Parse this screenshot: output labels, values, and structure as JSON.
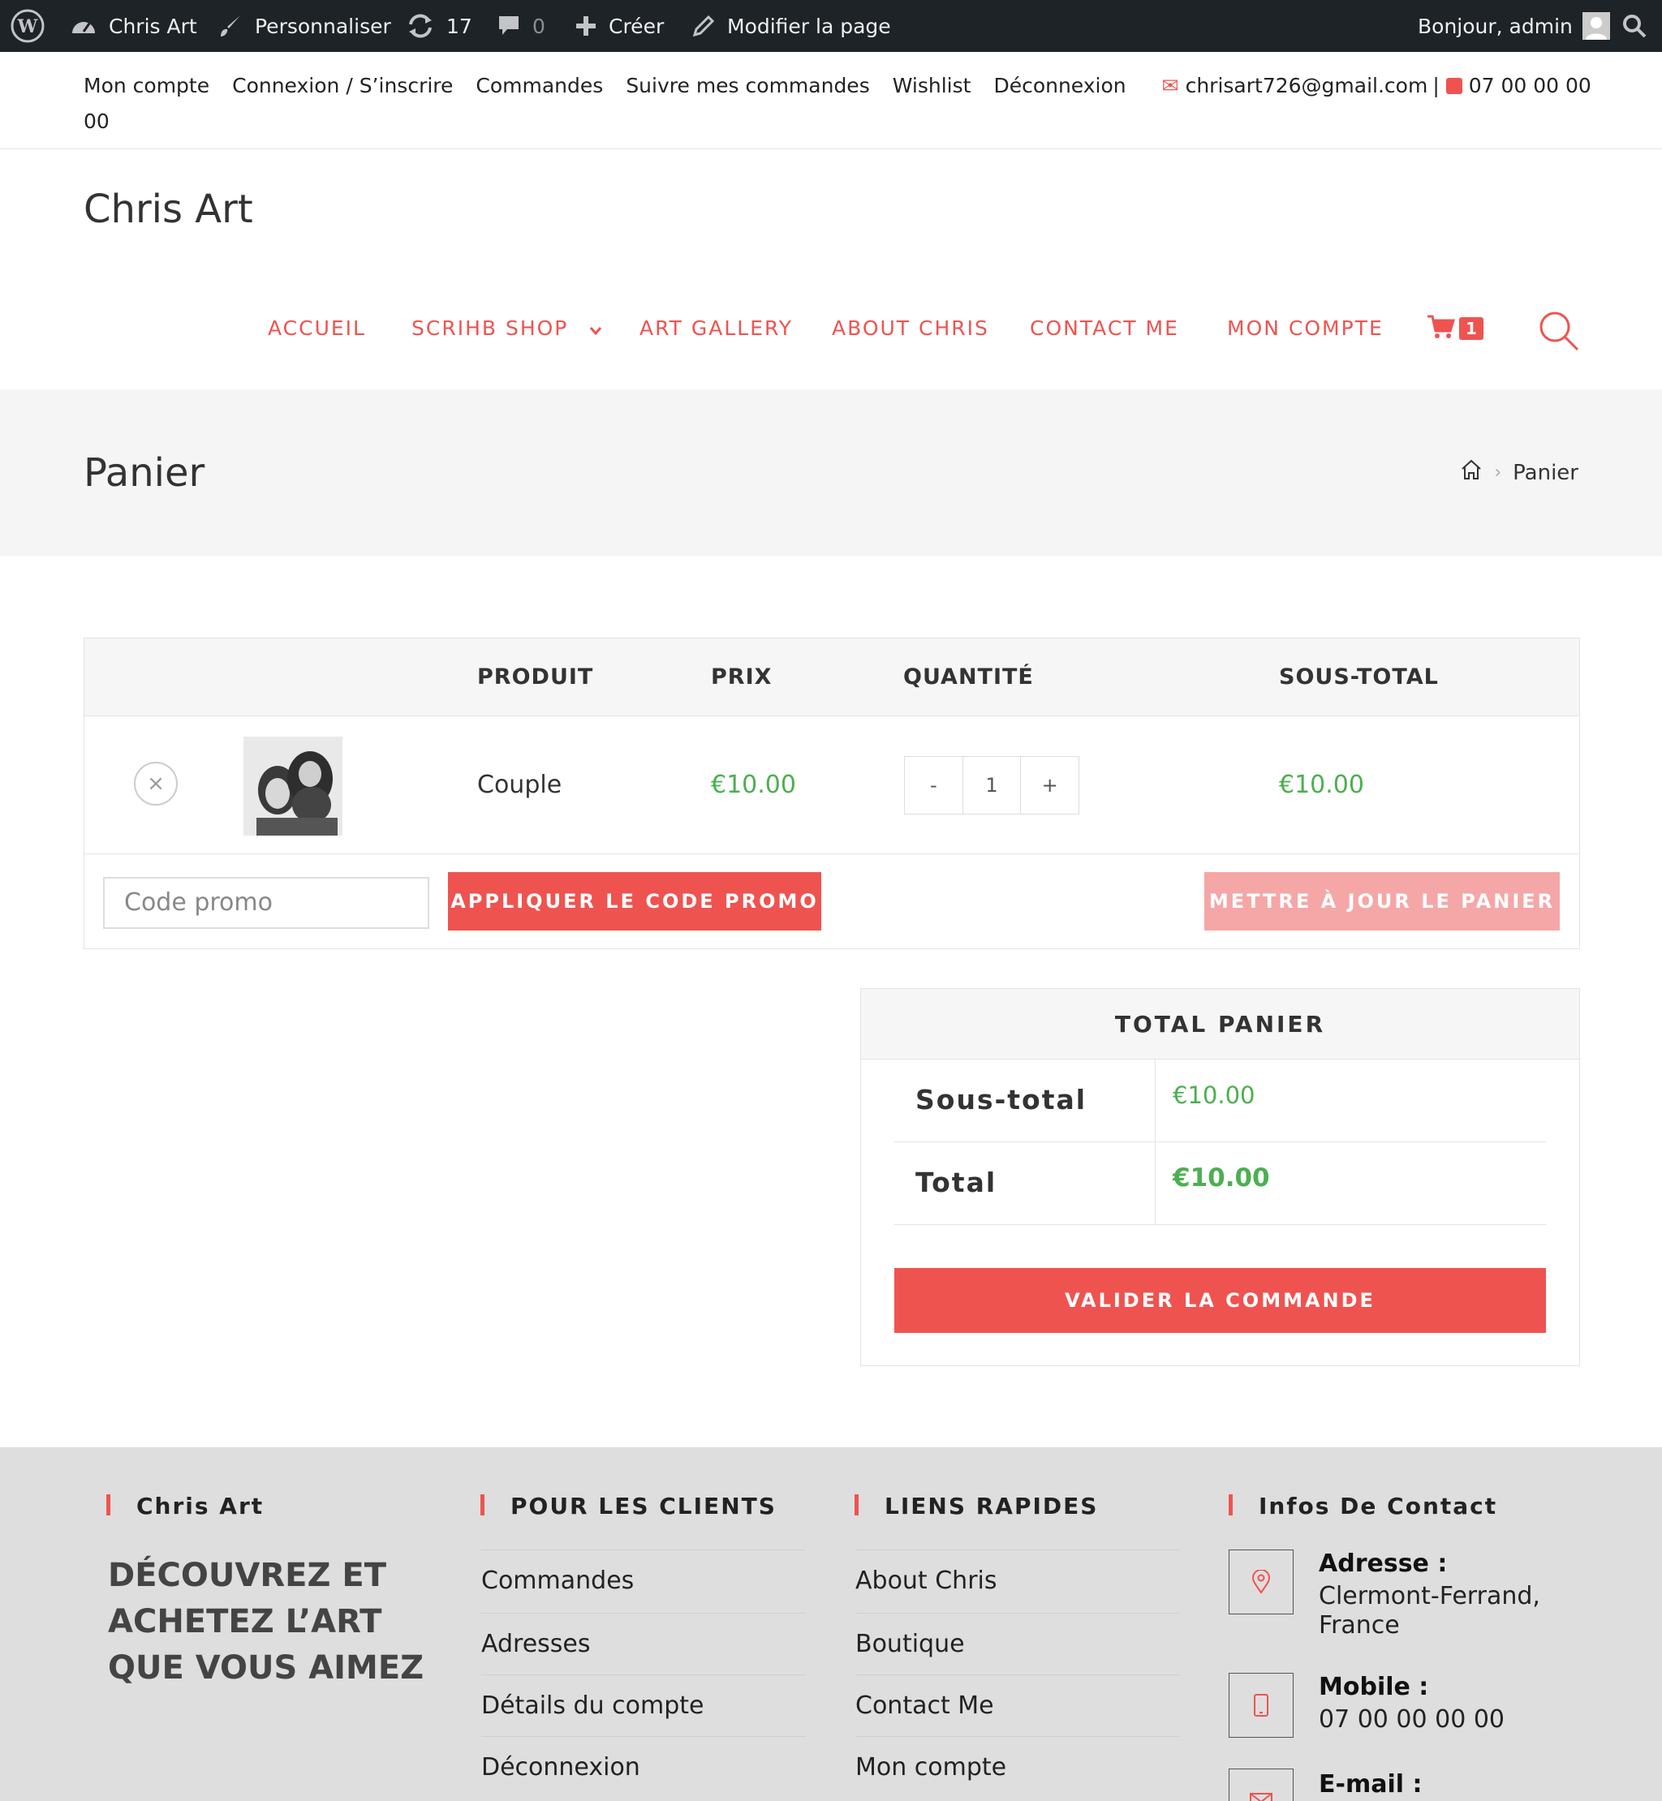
{
  "adminbar": {
    "site_name": "Chris Art",
    "customize": "Personnaliser",
    "updates_count": "17",
    "comments_count": "0",
    "create": "Créer",
    "edit_page": "Modifier la page",
    "greeting": "Bonjour, admin"
  },
  "topbar": {
    "links": [
      "Mon compte",
      "Connexion / S’inscrire",
      "Commandes",
      "Suivre mes commandes",
      "Wishlist",
      "Déconnexion"
    ],
    "email": "chrisart726@gmail.com",
    "separator": "|",
    "phone": "07 00 00 00 00"
  },
  "header": {
    "site_title": "Chris Art",
    "nav": [
      "ACCUEIL",
      "SCRIHB SHOP",
      "ART GALLERY",
      "ABOUT CHRIS",
      "CONTACT ME",
      "MON COMPTE"
    ],
    "cart_count": "1"
  },
  "page": {
    "title": "Panier",
    "breadcrumb_current": "Panier"
  },
  "cart": {
    "headers": {
      "product": "PRODUIT",
      "price": "PRIX",
      "quantity": "QUANTITÉ",
      "subtotal": "SOUS-TOTAL"
    },
    "item": {
      "name": "Couple",
      "price": "€10.00",
      "qty": "1",
      "qty_minus": "-",
      "qty_plus": "+",
      "subtotal": "€10.00",
      "remove": "×"
    },
    "coupon_placeholder": "Code promo",
    "apply_label": "APPLIQUER LE CODE PROMO",
    "update_label": "METTRE À JOUR LE PANIER"
  },
  "totals": {
    "title": "TOTAL PANIER",
    "subtotal_label": "Sous-total",
    "subtotal_value": "€10.00",
    "total_label": "Total",
    "total_value": "€10.00",
    "checkout_label": "VALIDER LA COMMANDE"
  },
  "footer": {
    "col1_title": "Chris Art",
    "tagline": "DÉCOUVREZ ET ACHETEZ L’ART QUE VOUS AIMEZ",
    "col2_title": "POUR LES CLIENTS",
    "col2_links": [
      "Commandes",
      "Adresses",
      "Détails du compte",
      "Déconnexion"
    ],
    "col3_title": "LIENS RAPIDES",
    "col3_links": [
      "About Chris",
      "Boutique",
      "Contact Me",
      "Mon compte"
    ],
    "col4_title": "Infos De Contact",
    "address_label": "Adresse :",
    "address_value": "Clermont-Ferrand, France",
    "mobile_label": "Mobile :",
    "mobile_value": "07 00 00 00 00",
    "email_label": "E-mail :"
  },
  "colors": {
    "accent": "#ef5350",
    "price": "#4caf50",
    "adminbar": "#1d2327",
    "footer_bg": "#dedede"
  }
}
